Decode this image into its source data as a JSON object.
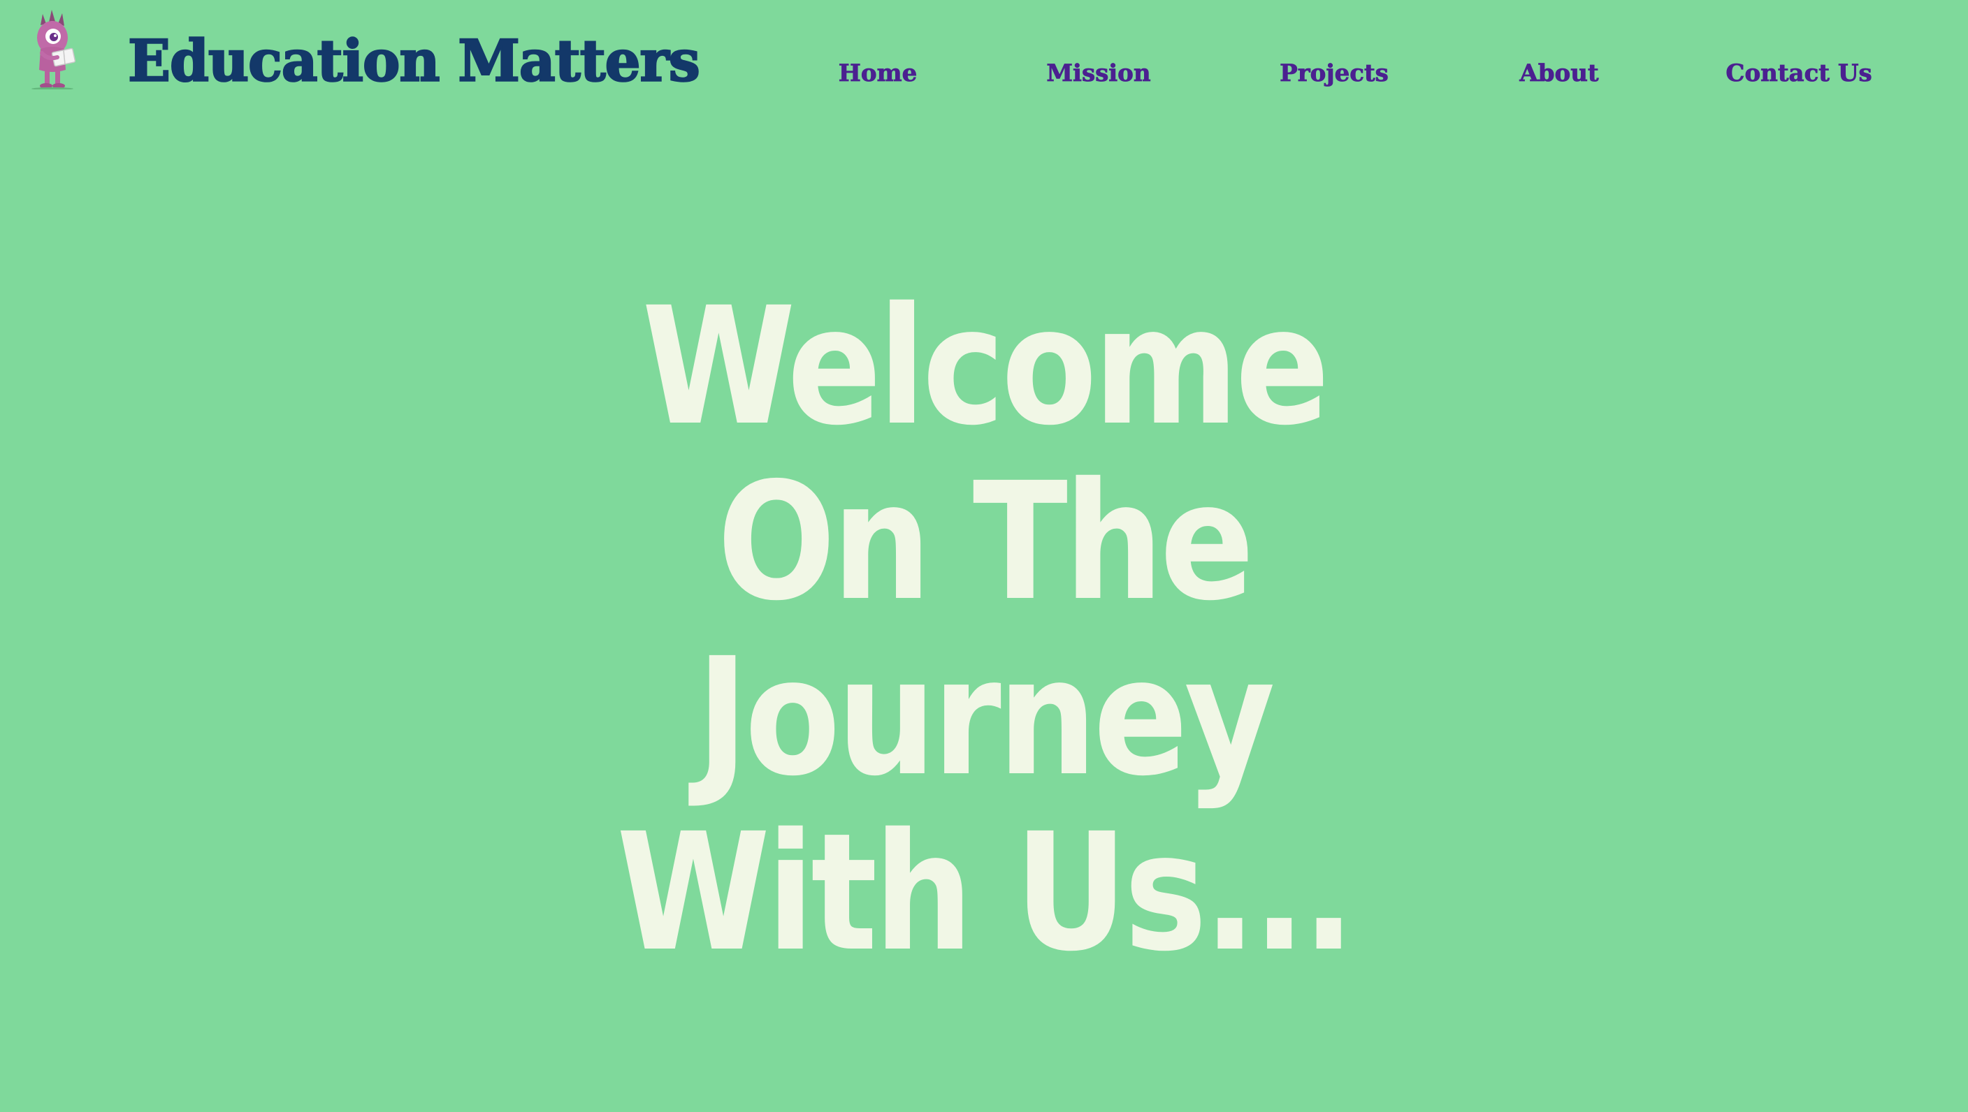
{
  "header": {
    "logo_icon": "monster-mascot-icon",
    "site_title": "Education Matters"
  },
  "nav": {
    "items": [
      {
        "label": "Home"
      },
      {
        "label": "Mission"
      },
      {
        "label": "Projects"
      },
      {
        "label": "About"
      },
      {
        "label": "Contact Us"
      }
    ]
  },
  "hero": {
    "lines": [
      "Welcome",
      "On The",
      "Journey",
      "With Us..."
    ]
  },
  "colors": {
    "background": "#7fd99b",
    "title": "#133869",
    "nav_link": "#4b2090",
    "hero_text": "#f1f7e6"
  }
}
